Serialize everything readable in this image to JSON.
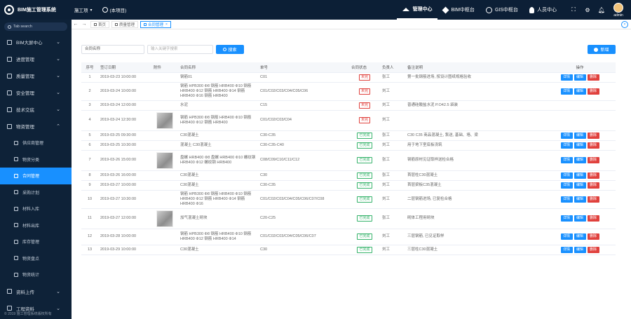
{
  "header": {
    "logo_text": "BIM施工管理系统",
    "project_label": "施工项",
    "project_scope": "(本项目)",
    "nav": [
      {
        "label": "管理中心",
        "icon": "home-icon",
        "active": true
      },
      {
        "label": "BIM中枢台",
        "icon": "cube-icon",
        "active": false
      },
      {
        "label": "GIS中枢台",
        "icon": "globe-icon",
        "active": false
      },
      {
        "label": "人员中心",
        "icon": "person-icon",
        "active": false
      }
    ],
    "username": "admin"
  },
  "sidebar": {
    "search_placeholder": "Tab search",
    "menus": [
      {
        "label": "BIM大屏中心",
        "icon": "dashboard-icon"
      },
      {
        "label": "进度管理",
        "icon": "schedule-icon"
      },
      {
        "label": "质量管理",
        "icon": "quality-icon"
      },
      {
        "label": "安全管理",
        "icon": "safety-icon"
      },
      {
        "label": "技术交底",
        "icon": "tech-icon"
      },
      {
        "label": "物资管理",
        "icon": "material-icon",
        "expanded": true
      }
    ],
    "submenus": [
      {
        "label": "供应商管理",
        "icon": "supplier-icon",
        "active": false
      },
      {
        "label": "物资分类",
        "icon": "category-icon",
        "active": false
      },
      {
        "label": "合同管理",
        "icon": "contract-icon",
        "active": true
      },
      {
        "label": "采购计划",
        "icon": "plan-icon",
        "active": false
      },
      {
        "label": "材料入库",
        "icon": "stock-in-icon",
        "active": false
      },
      {
        "label": "材料出库",
        "icon": "stock-out-icon",
        "active": false
      },
      {
        "label": "库存管理",
        "icon": "inventory-icon",
        "active": false
      },
      {
        "label": "物资盘点",
        "icon": "check-icon",
        "active": false
      },
      {
        "label": "物资统计",
        "icon": "stats-icon",
        "active": false
      }
    ],
    "menus_bottom": [
      {
        "label": "资料上传",
        "icon": "upload-icon"
      },
      {
        "label": "工程资料",
        "icon": "docs-icon"
      }
    ],
    "copyright": "© 2019 施工管理系统版权所有"
  },
  "tabs": [
    {
      "label": "首页",
      "active": false
    },
    {
      "label": "质量管理",
      "active": false
    },
    {
      "label": "合同管理",
      "active": true
    }
  ],
  "filters": {
    "select_value": "合同名称",
    "input_placeholder": "输入关键字搜索",
    "search_label": "搜索",
    "add_label": "新增"
  },
  "table": {
    "columns": [
      "序号",
      "签订日期",
      "附件",
      "合同名称",
      "单号",
      "合同状态",
      "负责人",
      "备注说明",
      "操作"
    ],
    "ops": {
      "detail": "详情",
      "edit": "编辑",
      "delete": "删除"
    },
    "rows": [
      {
        "no": "1",
        "date": "2019-03-23 10:00:00",
        "thumb": false,
        "name": "钢筋01",
        "code": "C01",
        "status": "未完",
        "status_color": "red",
        "owner": "张工",
        "note": "第一批钢筋进场, 按设计图纸规格验收",
        "ops": true
      },
      {
        "no": "2",
        "date": "2019-03-24 10:00:00",
        "thumb": false,
        "name": "钢筋 HPB300 Φ8 钢筋 HRB400 Φ10 钢筋 HRB400 Φ12 钢筋 HRB400 Φ14 钢筋 HRB400 Φ16 钢筋 HRB400",
        "code": "C01/C02/C03/C04/C05/C06",
        "status": "未完",
        "status_color": "red",
        "owner": "刘工",
        "note": "",
        "ops": true
      },
      {
        "no": "3",
        "date": "2019-03-24 12:00:00",
        "thumb": false,
        "name": "水泥",
        "code": "C15",
        "status": "未完",
        "status_color": "red",
        "owner": "刘工",
        "note": "普通硅酸盐水泥 P.O42.5 袋装",
        "ops": false
      },
      {
        "no": "4",
        "date": "2019-03-24 12:30:00",
        "thumb": true,
        "name": "钢筋 HPB300 Φ8 钢筋 HRB400 Φ10 钢筋 HRB400 Φ12 钢筋 HRB400",
        "code": "C01/C02/C03/C04",
        "status": "未完",
        "status_color": "red",
        "owner": "刘工",
        "note": "",
        "ops": false
      },
      {
        "no": "5",
        "date": "2019-03-25 09:30:00",
        "thumb": false,
        "name": "C30混凝土",
        "code": "C30-C35",
        "status": "已完成",
        "status_color": "green",
        "owner": "张工",
        "note": "C30 C35 商品混凝土, 泵送, 基础、墙、梁",
        "ops": true
      },
      {
        "no": "6",
        "date": "2019-03-25 10:30:00",
        "thumb": false,
        "name": "混凝土 C30混凝土",
        "code": "C30-C35-C40",
        "status": "已完成",
        "status_color": "green",
        "owner": "刘工",
        "note": "用于地下室底板浇筑",
        "ops": true
      },
      {
        "no": "7",
        "date": "2019-03-26 15:00:00",
        "thumb": true,
        "name": "盘螺 HRB400 Φ8 盘螺 HRB400 Φ10 螺纹钢 HRB400 Φ12 螺纹钢 HRB400",
        "code": "C08/C09/C10/C11/C12",
        "status": "已完成",
        "status_color": "green",
        "owner": "张工",
        "note": "钢筋原材见证取样送检合格",
        "ops": true
      },
      {
        "no": "8",
        "date": "2019-03-26 16:00:00",
        "thumb": false,
        "name": "C30混凝土",
        "code": "C30",
        "status": "已完成",
        "status_color": "green",
        "owner": "张工",
        "note": "首层柱C30混凝土",
        "ops": true
      },
      {
        "no": "9",
        "date": "2019-03-27 10:00:00",
        "thumb": false,
        "name": "C30混凝土",
        "code": "C30-C35",
        "status": "已完成",
        "status_color": "green",
        "owner": "刘工",
        "note": "首层梁板C35混凝土",
        "ops": true
      },
      {
        "no": "10",
        "date": "2019-03-27 10:30:00",
        "thumb": false,
        "name": "钢筋 HPB300 Φ8 钢筋 HRB400 Φ10 钢筋 HRB400 Φ12 钢筋 HRB400 Φ14 钢筋 HRB400 Φ16",
        "code": "C01/C02/C03/C04/C05/C06/C07/C08",
        "status": "已完成",
        "status_color": "green",
        "owner": "刘工",
        "note": "二层钢筋进场, 已复检合格",
        "ops": true
      },
      {
        "no": "11",
        "date": "2019-03-27 12:00:00",
        "thumb": true,
        "name": "加气混凝土砌块",
        "code": "C20-C25",
        "status": "已完成",
        "status_color": "green",
        "owner": "张工",
        "note": "砌体工程用砌块",
        "ops": true
      },
      {
        "no": "12",
        "date": "2019-03-28 10:00:00",
        "thumb": false,
        "name": "钢筋 HPB300 Φ8 钢筋 HRB400 Φ10 钢筋 HRB400 Φ12 钢筋 HRB400 Φ14",
        "code": "C01/C02/C03/C04/C05/C06/C07",
        "status": "已完成",
        "status_color": "green",
        "owner": "刘工",
        "note": "三层钢筋, 已见证取样",
        "ops": true
      },
      {
        "no": "13",
        "date": "2019-03-29 10:00:00",
        "thumb": false,
        "name": "C30混凝土",
        "code": "C30",
        "status": "已完成",
        "status_color": "green",
        "owner": "刘工",
        "note": "三层柱C30混凝土",
        "ops": true
      }
    ]
  }
}
